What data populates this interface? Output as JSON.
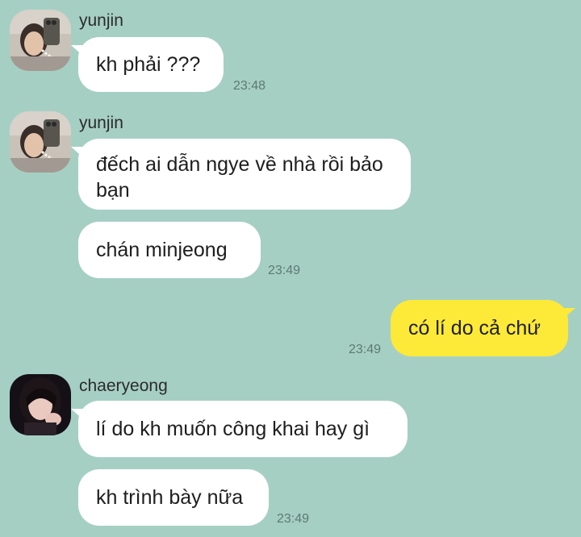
{
  "colors": {
    "background": "#a6cfc4",
    "incoming_bubble": "#ffffff",
    "outgoing_bubble": "#fde938",
    "timestamp": "#5d7a73"
  },
  "messages": [
    {
      "sender": "yunjin",
      "bubbles": [
        {
          "text": "kh phải ???",
          "time": "23:48"
        }
      ]
    },
    {
      "sender": "yunjin",
      "bubbles": [
        {
          "text": "đếch ai dẫn ngye về nhà rồi bảo bạn"
        },
        {
          "text": "chán minjeong",
          "time": "23:49"
        }
      ]
    },
    {
      "sender": "me",
      "bubbles": [
        {
          "text": "có lí do cả chứ",
          "time": "23:49"
        }
      ]
    },
    {
      "sender": "chaeryeong",
      "bubbles": [
        {
          "text": "lí do kh muốn công khai hay gì"
        },
        {
          "text": "kh trình bày nữa",
          "time": "23:49"
        }
      ]
    }
  ]
}
